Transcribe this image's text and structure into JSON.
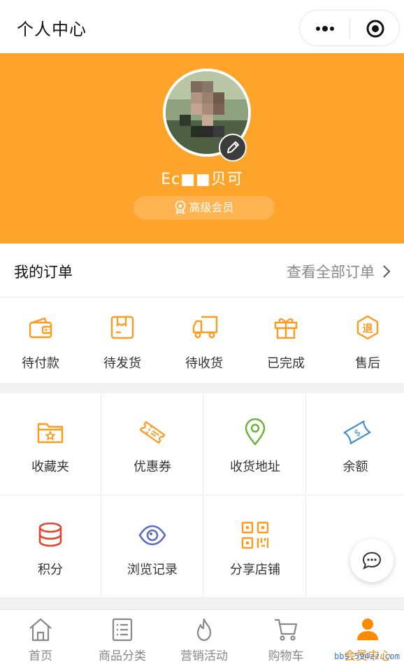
{
  "topbar": {
    "title": "个人中心"
  },
  "profile": {
    "username": "Ec■■贝可",
    "member_level": "高级会员"
  },
  "orders": {
    "title": "我的订单",
    "view_all": "查看全部订单",
    "items": [
      {
        "label": "待付款",
        "icon": "wallet-icon"
      },
      {
        "label": "待发货",
        "icon": "package-icon"
      },
      {
        "label": "待收货",
        "icon": "truck-icon"
      },
      {
        "label": "已完成",
        "icon": "gift-icon"
      },
      {
        "label": "售后",
        "icon": "refund-icon"
      }
    ]
  },
  "grid": {
    "items": [
      {
        "label": "收藏夹",
        "icon": "folder-star-icon"
      },
      {
        "label": "优惠券",
        "icon": "coupon-icon"
      },
      {
        "label": "收货地址",
        "icon": "location-pin-icon"
      },
      {
        "label": "余额",
        "icon": "money-icon"
      },
      {
        "label": "积分",
        "icon": "coins-stack-icon"
      },
      {
        "label": "浏览记录",
        "icon": "eye-icon"
      },
      {
        "label": "分享店铺",
        "icon": "qr-code-icon"
      }
    ]
  },
  "tabbar": {
    "items": [
      {
        "label": "首页",
        "icon": "home-icon"
      },
      {
        "label": "商品分类",
        "icon": "list-icon"
      },
      {
        "label": "营销活动",
        "icon": "flame-icon"
      },
      {
        "label": "购物车",
        "icon": "cart-icon"
      },
      {
        "label": "会员中心",
        "icon": "user-icon",
        "active": true
      }
    ]
  },
  "watermark": "bbs.594zz.com",
  "colors": {
    "accent": "#ffa42b",
    "tab_active": "#ff8a00",
    "red": "#e3452d",
    "green": "#6ab033",
    "blue": "#3f8ccf",
    "purple": "#5b6bc0"
  }
}
